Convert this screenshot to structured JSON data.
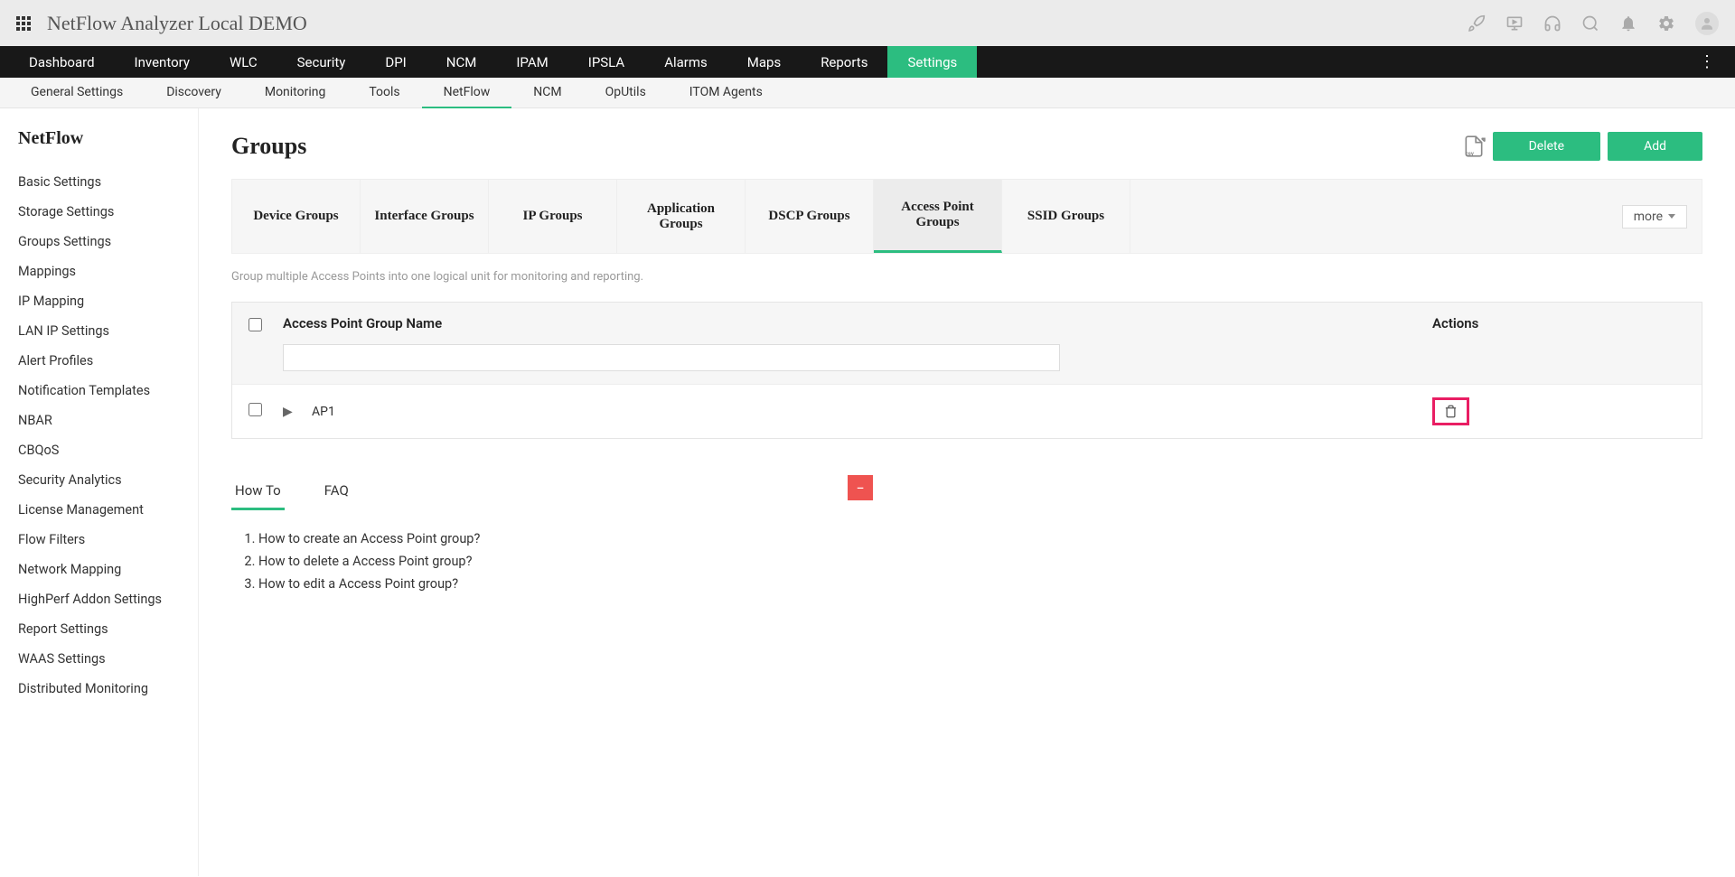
{
  "app_title": "NetFlow Analyzer Local DEMO",
  "main_nav": {
    "items": [
      "Dashboard",
      "Inventory",
      "WLC",
      "Security",
      "DPI",
      "NCM",
      "IPAM",
      "IPSLA",
      "Alarms",
      "Maps",
      "Reports",
      "Settings"
    ],
    "active_index": 11
  },
  "sub_nav": {
    "items": [
      "General Settings",
      "Discovery",
      "Monitoring",
      "Tools",
      "NetFlow",
      "NCM",
      "OpUtils",
      "ITOM Agents"
    ],
    "active_index": 4
  },
  "sidebar": {
    "title": "NetFlow",
    "items": [
      "Basic Settings",
      "Storage Settings",
      "Groups Settings",
      "Mappings",
      "IP Mapping",
      "LAN IP Settings",
      "Alert Profiles",
      "Notification Templates",
      "NBAR",
      "CBQoS",
      "Security Analytics",
      "License Management",
      "Flow Filters",
      "Network Mapping",
      "HighPerf Addon Settings",
      "Report Settings",
      "WAAS Settings",
      "Distributed Monitoring"
    ]
  },
  "page": {
    "title": "Groups",
    "csv_label": "csv",
    "delete_btn": "Delete",
    "add_btn": "Add"
  },
  "group_tabs": {
    "items": [
      "Device Groups",
      "Interface Groups",
      "IP Groups",
      "Application Groups",
      "DSCP Groups",
      "Access Point Groups",
      "SSID Groups"
    ],
    "active_index": 5,
    "more": "more"
  },
  "description": "Group multiple Access Points into one logical unit for monitoring and reporting.",
  "table": {
    "col_name": "Access Point Group Name",
    "col_actions": "Actions",
    "filter_value": "",
    "rows": [
      {
        "name": "AP1"
      }
    ]
  },
  "help": {
    "tabs": [
      "How To",
      "FAQ"
    ],
    "active_index": 0,
    "items": [
      "How to create an Access Point group?",
      "How to delete a Access Point group?",
      "How to edit a Access Point group?"
    ]
  }
}
